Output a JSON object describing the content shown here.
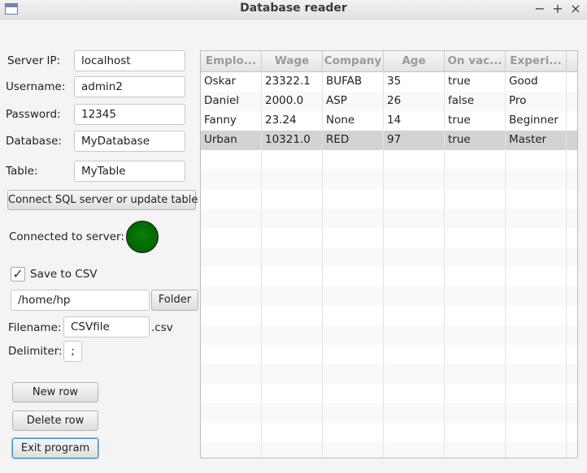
{
  "window": {
    "title": "Database reader",
    "minimize": "−",
    "maximize": "+",
    "close": "×"
  },
  "connection": {
    "server_ip_label": "Server IP:",
    "server_ip_value": "localhost",
    "username_label": "Username:",
    "username_value": "admin2",
    "password_label": "Password:",
    "password_value": "12345",
    "database_label": "Database:",
    "database_value": "MyDatabase",
    "table_label": "Table:",
    "table_value": "MyTable",
    "connect_button": "Connect SQL server or update table",
    "connected_label": "Connected to server:",
    "status_color": "#006400"
  },
  "csv": {
    "save_label": "Save to CSV",
    "save_checked": true,
    "check_mark": "✓",
    "folder_path": "/home/hp",
    "folder_button": "Folder",
    "filename_label": "Filename:",
    "filename_value": "CSVfile",
    "extension": ".csv",
    "delimiter_label": "Delimiter:",
    "delimiter_value": ";"
  },
  "actions": {
    "new_row": "New row",
    "delete_row": "Delete row",
    "exit": "Exit program"
  },
  "table": {
    "columns": [
      "Emplo...",
      "Wage",
      "Company",
      "Age",
      "On vac...",
      "Experi..."
    ],
    "rows": [
      [
        "Oskar",
        "23322.1",
        "BUFAB",
        "35",
        "true",
        "Good"
      ],
      [
        "Daniel",
        "2000.0",
        "ASP",
        "26",
        "false",
        "Pro"
      ],
      [
        "Fanny",
        "23.24",
        "None",
        "14",
        "true",
        "Beginner"
      ],
      [
        "Urban",
        "10321.0",
        "RED",
        "97",
        "true",
        "Master"
      ]
    ],
    "selected_row": 3
  }
}
